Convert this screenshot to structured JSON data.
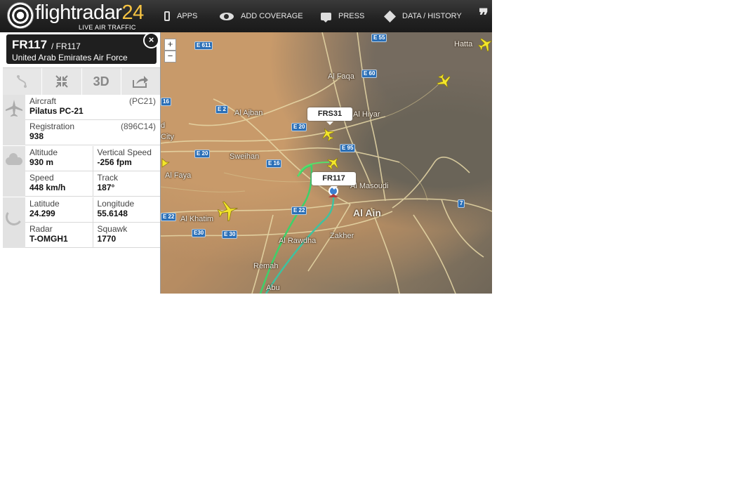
{
  "brand": {
    "name_main": "flightradar",
    "name_num": "24",
    "tagline": "LIVE AIR TRAFFIC"
  },
  "nav": [
    {
      "label": "APPS",
      "icon": "phone-icon"
    },
    {
      "label": "ADD COVERAGE",
      "icon": "eye-icon"
    },
    {
      "label": "PRESS",
      "icon": "chat-icon"
    },
    {
      "label": "DATA / HISTORY",
      "icon": "box-icon"
    }
  ],
  "flight": {
    "id": "FR117",
    "code": "/ FR117",
    "operator": "United Arab Emirates Air Force",
    "close": "×"
  },
  "toolbar": {
    "route_icon": "route-icon",
    "shrink_icon": "collapse-icon",
    "three_d": "3D",
    "share_icon": "share-icon"
  },
  "details": {
    "aircraft_label": "Aircraft",
    "aircraft_value": "Pilatus PC-21",
    "aircraft_code": "(PC21)",
    "registration_label": "Registration",
    "registration_value": "938",
    "registration_code": "(896C14)",
    "altitude_label": "Altitude",
    "altitude_value": "930 m",
    "vspeed_label": "Vertical Speed",
    "vspeed_value": "-256 fpm",
    "speed_label": "Speed",
    "speed_value": "448 km/h",
    "track_label": "Track",
    "track_value": "187°",
    "lat_label": "Latitude",
    "lat_value": "24.299",
    "lon_label": "Longitude",
    "lon_value": "55.6148",
    "radar_label": "Radar",
    "radar_value": "T-OMGH1",
    "squawk_label": "Squawk",
    "squawk_value": "1770"
  },
  "map": {
    "zoom_in": "+",
    "zoom_out": "−",
    "callouts": {
      "frs31": "FRS31",
      "fr117": "FR117"
    },
    "places": {
      "hatta": "Hatta",
      "al_faqa": "Al Faqa",
      "al_ajban": "Al Ajban",
      "al_hiyar": "Al Hiyar",
      "city": "City",
      "sweihan": "Sweihan",
      "al_faya": "Al Faya",
      "al_masoudi": "Al Masoudi",
      "al_ain": "Al Ain",
      "al_khatim": "Al Khatim",
      "zakher": "Zakher",
      "al_rawdha": "Al Rawdha",
      "remah": "Remah",
      "abu": "Abu",
      "d": "d"
    },
    "shields": {
      "e55": "E 55",
      "e611": "E 611",
      "e60": "E 60",
      "s16": "16",
      "e2": "E 2",
      "e20a": "E 20",
      "e95": "E 95",
      "e20b": "E 20",
      "e16": "E 16",
      "e22a": "E 22",
      "e22b": "E 22",
      "e30a": "E30",
      "e30b": "E 30",
      "s7": "7"
    }
  }
}
